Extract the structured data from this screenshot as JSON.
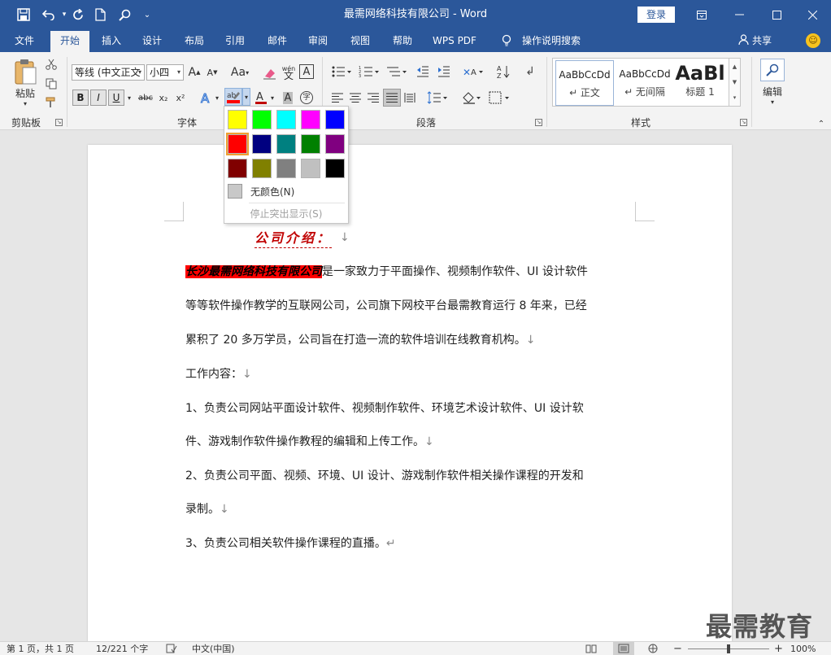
{
  "window": {
    "title": "最需网络科技有限公司 - Word",
    "login_label": "登录",
    "accent_color": "#2b579a"
  },
  "quick_access": [
    {
      "icon": "save-icon",
      "glyph": "💾"
    },
    {
      "icon": "undo-icon",
      "glyph": "↶"
    },
    {
      "icon": "redo-icon",
      "glyph": "↻"
    },
    {
      "icon": "new-document-icon",
      "glyph": "🗋"
    },
    {
      "icon": "search-icon",
      "glyph": "⌕"
    },
    {
      "icon": "customize-icon",
      "glyph": "⌄"
    }
  ],
  "tabs": [
    "文件",
    "开始",
    "插入",
    "设计",
    "布局",
    "引用",
    "邮件",
    "审阅",
    "视图",
    "帮助",
    "WPS PDF",
    "操作说明搜索"
  ],
  "active_tab": "开始",
  "share_label": "共享",
  "ribbon": {
    "clipboard": {
      "label": "剪贴板",
      "paste_label": "粘贴"
    },
    "font": {
      "label": "字体",
      "font_name": "等线 (中文正文",
      "font_size": "小四",
      "bold": "B",
      "italic": "I",
      "underline": "U",
      "strike": "abc",
      "subscript": "x₂",
      "superscript": "x²",
      "grow": "A",
      "shrink": "A",
      "case": "Aa",
      "pinyin": "wén",
      "border_char": "A",
      "shade_char": "A",
      "enclose_char": "字"
    },
    "paragraph": {
      "label": "段落"
    },
    "styles": {
      "label": "样式",
      "items": [
        {
          "sample": "AaBbCcDd",
          "name": "↵ 正文"
        },
        {
          "sample": "AaBbCcDd",
          "name": "↵ 无间隔"
        },
        {
          "sample": "AaBl",
          "name": "标题 1"
        }
      ]
    },
    "editing": {
      "label": "编辑"
    }
  },
  "highlight_dropdown": {
    "colors": [
      [
        "#ffff00",
        "#00ff00",
        "#00ffff",
        "#ff00ff",
        "#0000ff"
      ],
      [
        "#ff0000",
        "#000080",
        "#008080",
        "#008000",
        "#800080"
      ],
      [
        "#800000",
        "#808000",
        "#808080",
        "#c0c0c0",
        "#000000"
      ]
    ],
    "selected": "#ff0000",
    "no_color_label": "无颜色(N)",
    "stop_label": "停止突出显示(S)"
  },
  "document": {
    "title": "公司介绍：",
    "para1_highlight": "长沙最需网络科技有限公司",
    "para1_line1_rest": "是一家致力于平面操作、视频制作软件、UI 设计软件",
    "para1_line2": "等等软件操作教学的互联网公司，公司旗下网校平台最需教育运行 8 年来，已经",
    "para1_line3": "累积了 20 多万学员，公司旨在打造一流的软件培训在线教育机构。",
    "work_heading": "工作内容：",
    "item1_line1": "1、负责公司网站平面设计软件、视频制作软件、环境艺术设计软件、UI 设计软",
    "item1_line2": "件、游戏制作软件操作教程的编辑和上传工作。",
    "item2_line1": "2、负责公司平面、视频、环境、UI 设计、游戏制作软件相关操作课程的开发和",
    "item2_line2": "录制。",
    "item3": "3、负责公司相关软件操作课程的直播。",
    "para_mark": "↓",
    "end_mark": "↵"
  },
  "statusbar": {
    "page": "第 1 页，共 1 页",
    "words": "12/221 个字",
    "language": "中文(中国)",
    "zoom": "100%"
  },
  "watermark": "最需教育"
}
